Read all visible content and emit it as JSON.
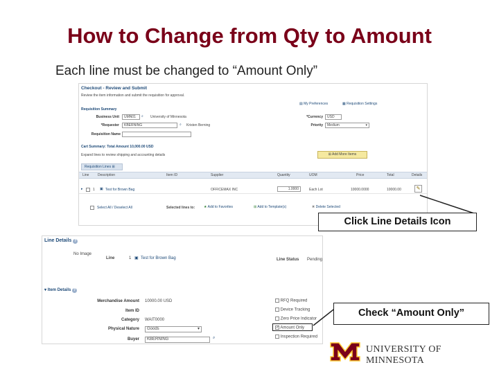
{
  "slide": {
    "title": "How to Change from Qty to Amount",
    "subtitle": "Each line must be changed to “Amount Only”"
  },
  "checkout": {
    "title": "Checkout - Review and Submit",
    "intro": "Review the item information and submit the requisition for approval.",
    "my_preferences": "My Preferences",
    "requisition_settings": "Requisition Settings",
    "summary_title": "Requisition Summary",
    "business_unit_label": "Business Unit",
    "business_unit_value": "UMN01",
    "business_unit_desc": "University of Minnesota",
    "requester_label": "*Requester",
    "requester_value": "KBERNING",
    "requester_desc": "Kristen Berning",
    "requisition_name_label": "Requisition Name",
    "currency_label": "*Currency",
    "currency_value": "USD",
    "priority_label": "Priority",
    "priority_value": "Medium",
    "cart_summary": "Cart Summary: Total Amount 10,000.00 USD",
    "expand_text": "Expand lines to review shipping and accounting details",
    "add_more_items": "Add More Items",
    "requisition_lines_tab": "Requisition Lines",
    "columns": [
      "Line",
      "Description",
      "Item ID",
      "Supplier",
      "Quantity",
      "UOM",
      "Price",
      "Total",
      "Details"
    ],
    "row": {
      "line": "1",
      "description": "Test for Brown Bag",
      "item_id": "",
      "supplier": "OFFICEMAX INC",
      "quantity": "1.0000",
      "uom": "Each Lot",
      "price": "10000.0000",
      "total": "10000.00"
    },
    "select_all": "Select All / Deselect All",
    "selected_lines_to": "Selected lines to:",
    "add_to_favorites": "Add to Favorites",
    "add_to_template": "Add to Template(s)",
    "delete_selected": "Delete Selected"
  },
  "line_details": {
    "title": "Line Details",
    "no_image": "No Image",
    "line_label": "Line",
    "line_value": "1",
    "line_desc": "Test for Brown Bag",
    "line_status_label": "Line Status",
    "line_status_value": "Pending",
    "item_details": "Item Details",
    "merch_amount_label": "Merchandise Amount",
    "merch_amount_value": "10000.00 USD",
    "item_id_label": "Item ID",
    "category_label": "Category",
    "category_value": "WAIT0000",
    "physical_nature_label": "Physical Nature",
    "physical_nature_value": "Goods",
    "buyer_label": "Buyer",
    "buyer_value": "KBERNING",
    "checkboxes": [
      {
        "label": "RFQ Required",
        "checked": false
      },
      {
        "label": "Device Tracking",
        "checked": false
      },
      {
        "label": "Zero Price Indicator",
        "checked": false
      },
      {
        "label": "Amount Only",
        "checked": true
      },
      {
        "label": "Inspection Required",
        "checked": false
      }
    ]
  },
  "callouts": {
    "line_details_icon": "Click Line Details Icon",
    "amount_only": "Check “Amount Only”"
  },
  "logo": {
    "text": "University of Minnesota",
    "color": "#7a0019",
    "gold": "#ffcc33"
  },
  "colors": {
    "title": "#7a0019",
    "link": "#1e4a78"
  }
}
